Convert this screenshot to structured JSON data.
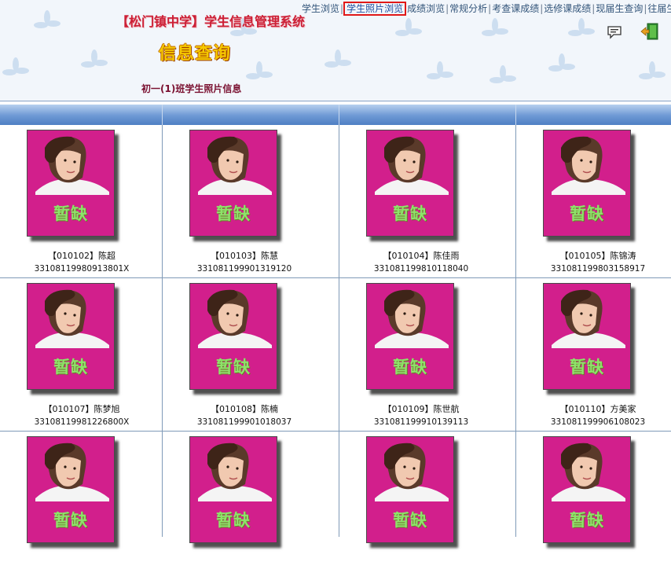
{
  "nav": {
    "items": [
      {
        "label": "学生浏览",
        "active": false
      },
      {
        "label": "学生照片浏览",
        "active": true
      },
      {
        "label": "成绩浏览",
        "active": false
      },
      {
        "label": "常规分析",
        "active": false
      },
      {
        "label": "考查课成绩",
        "active": false
      },
      {
        "label": "选修课成绩",
        "active": false
      },
      {
        "label": "现届生查询",
        "active": false
      },
      {
        "label": "往届生",
        "active": false
      }
    ],
    "separator": "|"
  },
  "header": {
    "school_title": "【松门镇中学】学生信息管理系统",
    "page_heading": "信息查询",
    "class_caption": "初一(1)班学生照片信息",
    "icons": [
      "message-icon",
      "exit-door-icon"
    ]
  },
  "theme": {
    "accent": "#4f80c4",
    "photo_bg": "#d21f8c",
    "missing_text": "#8ee36a",
    "title_red": "#cc1f35",
    "heading_gold": "#f5c800"
  },
  "photo_placeholder": "暂缺",
  "students": [
    {
      "label": "【010102】陈超",
      "id_number": "33108119980913801X"
    },
    {
      "label": "【010103】陈慧",
      "id_number": "331081199901319120"
    },
    {
      "label": "【010104】陈佳雨",
      "id_number": "331081199810118040"
    },
    {
      "label": "【010105】陈锦涛",
      "id_number": "331081199803158917"
    },
    {
      "label": "【010107】陈梦旭",
      "id_number": "33108119981226800X"
    },
    {
      "label": "【010108】陈楠",
      "id_number": "331081199901018037"
    },
    {
      "label": "【010109】陈世航",
      "id_number": "331081199910139113"
    },
    {
      "label": "【010110】方美家",
      "id_number": "331081199906108023"
    },
    {
      "label": "",
      "id_number": ""
    },
    {
      "label": "",
      "id_number": ""
    },
    {
      "label": "",
      "id_number": ""
    },
    {
      "label": "",
      "id_number": ""
    }
  ]
}
